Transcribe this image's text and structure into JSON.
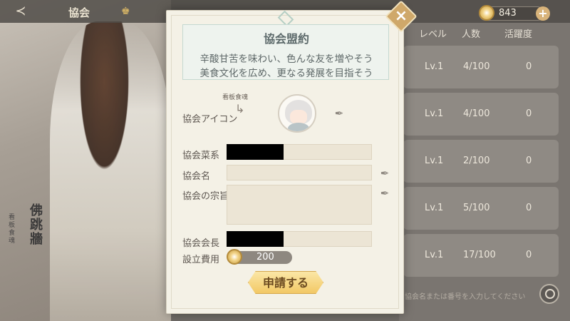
{
  "topbar": {
    "title": "協会",
    "coin_amount": "843"
  },
  "list": {
    "header_level": "レベル",
    "header_members": "人数",
    "header_activity": "活躍度",
    "rows": [
      {
        "level": "Lv.1",
        "members": "4/100",
        "activity": "0"
      },
      {
        "level": "Lv.1",
        "members": "4/100",
        "activity": "0"
      },
      {
        "level": "Lv.1",
        "members": "2/100",
        "activity": "0"
      },
      {
        "level": "Lv.1",
        "members": "5/100",
        "activity": "0"
      },
      {
        "level": "Lv.1",
        "members": "17/100",
        "activity": "0"
      }
    ],
    "search_placeholder": "協会名または番号を入力してください"
  },
  "character": {
    "name": "佛跳牆",
    "sub": "看板食魂"
  },
  "modal": {
    "pledge_title": "協会盟約",
    "pledge_line1": "辛酸甘苦を味わい、色んな友を増やそう",
    "pledge_line2": "美食文化を広め、更なる発展を目指そう",
    "icon_caption": "看板食魂",
    "icon_label": "協会アイコン",
    "cuisine_label": "協会菜系",
    "name_label": "協会名",
    "purpose_label": "協会の宗旨",
    "leader_label": "協会会長",
    "cost_label": "設立費用",
    "cost_value": "200",
    "apply_button": "申請する"
  },
  "icons": [
    "back-icon",
    "crown-icon",
    "coin-icon",
    "plus-icon",
    "close-icon",
    "edit-icon",
    "search-icon",
    "arrow-icon"
  ]
}
